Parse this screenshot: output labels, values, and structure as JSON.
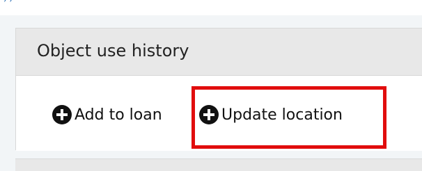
{
  "top_text": ", ,",
  "panel": {
    "title": "Object use history",
    "actions": [
      {
        "label": "Add to loan",
        "icon": "plus-circle-icon"
      },
      {
        "label": "Update location",
        "icon": "plus-circle-icon"
      }
    ]
  },
  "highlight_color": "#e10d0d"
}
